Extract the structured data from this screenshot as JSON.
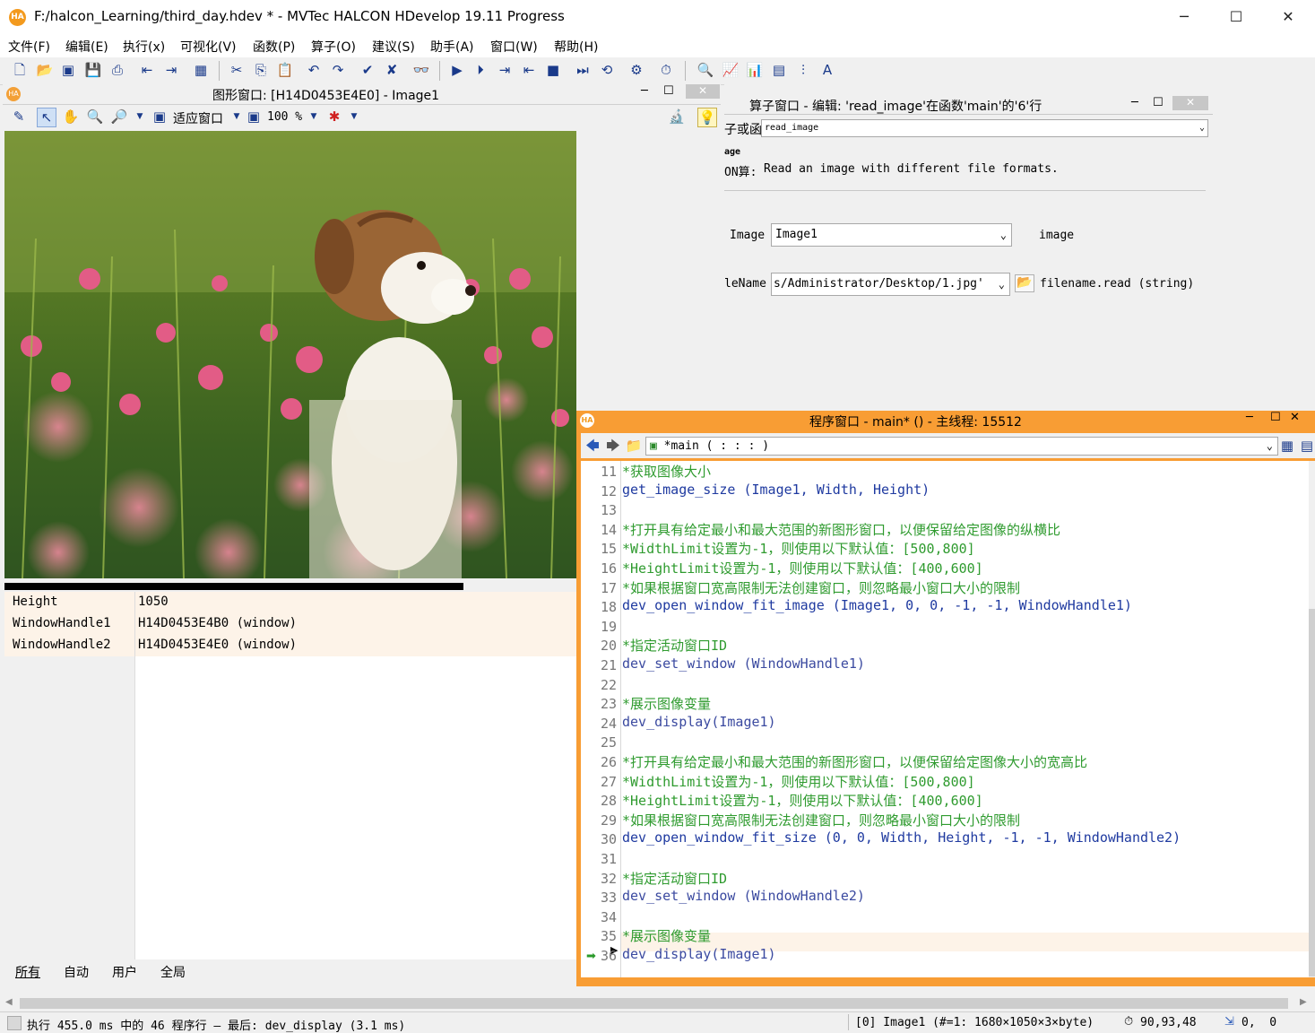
{
  "app": {
    "title": "F:/halcon_Learning/third_day.hdev * - MVTec HALCON HDevelop 19.11 Progress",
    "logo": "HA"
  },
  "window_controls": {
    "minimize": "─",
    "maximize": "☐",
    "close": "✕"
  },
  "menu": [
    "文件(F)",
    "编辑(E)",
    "执行(x)",
    "可视化(V)",
    "函数(P)",
    "算子(O)",
    "建议(S)",
    "助手(A)",
    "窗口(W)",
    "帮助(H)"
  ],
  "graphics_window": {
    "title": "图形窗口: [H14D0453E4E0] - Image1",
    "fit_label": "适应窗口",
    "zoom_label": "100 %",
    "photo_description_icon": "puppy-photo"
  },
  "variables": [
    {
      "name": "Height",
      "value": "1050"
    },
    {
      "name": "WindowHandle1",
      "value": "H14D0453E4B0 (window)"
    },
    {
      "name": "WindowHandle2",
      "value": "H14D0453E4E0 (window)"
    }
  ],
  "var_tabs": [
    "所有",
    "自动",
    "用户",
    "全局"
  ],
  "operator_window": {
    "title": "算子窗口 - 编辑:  'read_image'在函数'main'的'6'行",
    "selector_label": "子或函",
    "selector_value": "read_image",
    "op_name": "read_image",
    "op_short": "ON算:",
    "op_description": "Read an image with different file formats.",
    "param1_label": "Image",
    "param1_value": "Image1",
    "param1_type": "image",
    "param2_label": "leName",
    "param2_value": "s/Administrator/Desktop/1.jpg'",
    "param2_type": "filename.read (string)"
  },
  "program_window": {
    "title": "程序窗口 - main* () - 主线程: 15512",
    "procedure": "*main ( : : : )",
    "lines": [
      {
        "n": "11",
        "kind": "c-com",
        "text": "*获取图像大小"
      },
      {
        "n": "12",
        "kind": "c-op",
        "text": "get_image_size (Image1, Width, Height)"
      },
      {
        "n": "13",
        "kind": "",
        "text": ""
      },
      {
        "n": "14",
        "kind": "c-com",
        "text": "*打开具有给定最小和最大范围的新图形窗口，以便保留给定图像的纵横比"
      },
      {
        "n": "15",
        "kind": "c-com",
        "text": "*WidthLimit设置为-1，则使用以下默认值：[500,800]"
      },
      {
        "n": "16",
        "kind": "c-com",
        "text": "*HeightLimit设置为-1，则使用以下默认值：[400,600]"
      },
      {
        "n": "17",
        "kind": "c-com",
        "text": "*如果根据窗口宽高限制无法创建窗口，则忽略最小窗口大小的限制"
      },
      {
        "n": "18",
        "kind": "c-op",
        "text": "dev_open_window_fit_image (Image1, 0, 0, -1, -1, WindowHandle1)"
      },
      {
        "n": "19",
        "kind": "",
        "text": ""
      },
      {
        "n": "20",
        "kind": "c-com",
        "text": "*指定活动窗口ID"
      },
      {
        "n": "21",
        "kind": "c-dev",
        "text": "dev_set_window (WindowHandle1)"
      },
      {
        "n": "22",
        "kind": "",
        "text": ""
      },
      {
        "n": "23",
        "kind": "c-com",
        "text": "*展示图像变量"
      },
      {
        "n": "24",
        "kind": "c-dev",
        "text": "dev_display(Image1)"
      },
      {
        "n": "25",
        "kind": "",
        "text": ""
      },
      {
        "n": "26",
        "kind": "c-com",
        "text": "*打开具有给定最小和最大范围的新图形窗口，以便保留给定图像大小的宽高比"
      },
      {
        "n": "27",
        "kind": "c-com",
        "text": "*WidthLimit设置为-1，则使用以下默认值：[500,800]"
      },
      {
        "n": "28",
        "kind": "c-com",
        "text": "*HeightLimit设置为-1，则使用以下默认值：[400,600]"
      },
      {
        "n": "29",
        "kind": "c-com",
        "text": "*如果根据窗口宽高限制无法创建窗口，则忽略最小窗口大小的限制"
      },
      {
        "n": "30",
        "kind": "c-op",
        "text": "dev_open_window_fit_size (0, 0, Width, Height, -1, -1, WindowHandle2)"
      },
      {
        "n": "31",
        "kind": "",
        "text": ""
      },
      {
        "n": "32",
        "kind": "c-com",
        "text": "*指定活动窗口ID"
      },
      {
        "n": "33",
        "kind": "c-dev",
        "text": "dev_set_window (WindowHandle2)"
      },
      {
        "n": "34",
        "kind": "",
        "text": ""
      },
      {
        "n": "35",
        "kind": "c-com",
        "text": "*展示图像变量"
      },
      {
        "n": "36",
        "kind": "c-dev",
        "text": "dev_display(Image1)"
      }
    ]
  },
  "status": {
    "left": "执行 455.0 ms 中的 46 程序行 — 最后: dev_display (3.1 ms)",
    "image_info": "[0] Image1 (#=1: 1680×1050×3×byte)",
    "pixel_value": "90,93,48",
    "coords": "0,  0"
  }
}
